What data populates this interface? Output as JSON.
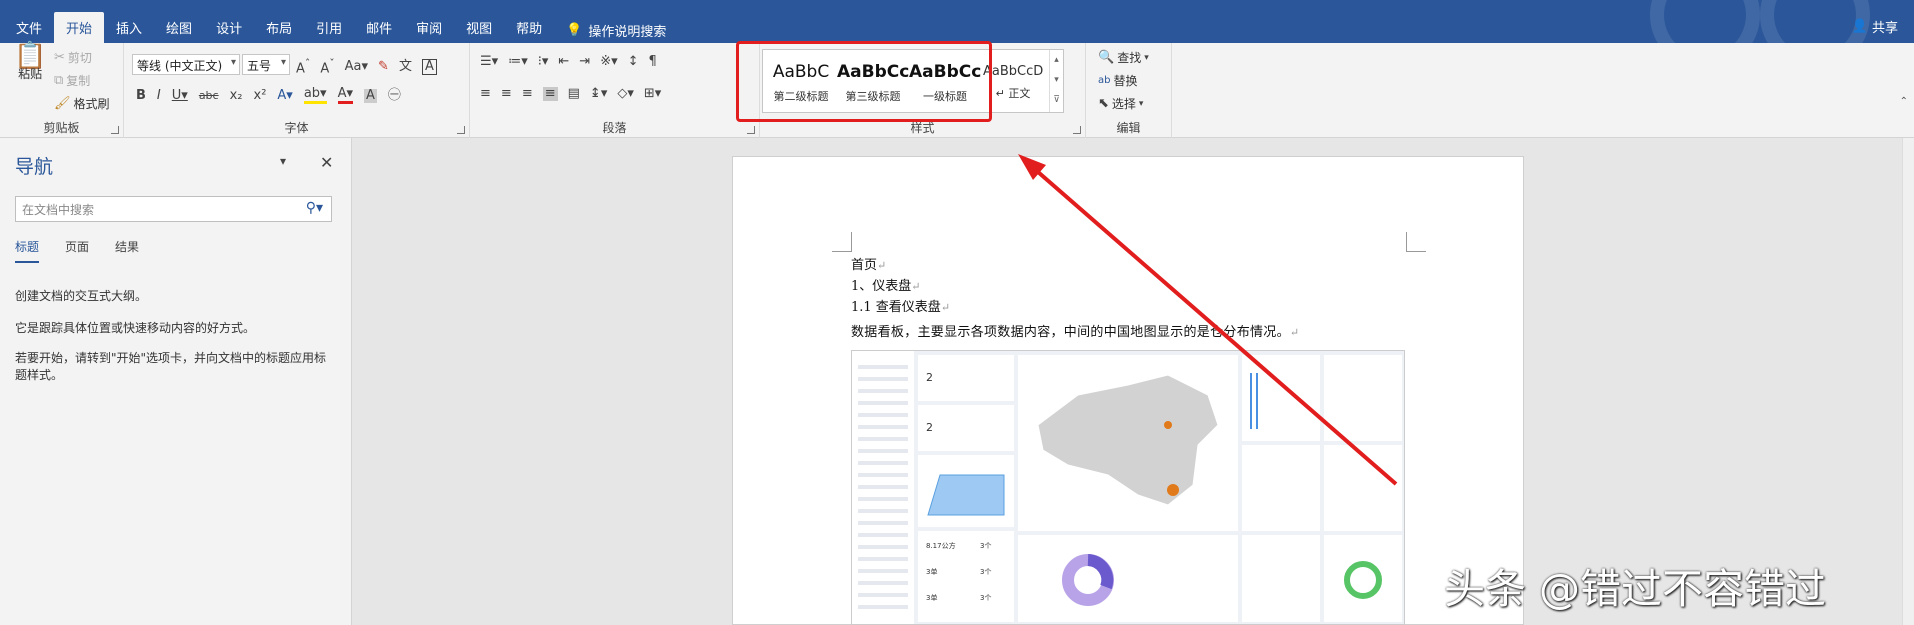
{
  "tabs": [
    "文件",
    "开始",
    "插入",
    "绘图",
    "设计",
    "布局",
    "引用",
    "邮件",
    "审阅",
    "视图",
    "帮助"
  ],
  "tell_me": "操作说明搜索",
  "share": "共享",
  "clipboard": {
    "paste": "粘贴",
    "cut": "剪切",
    "copy": "复制",
    "format_painter": "格式刷",
    "label": "剪贴板"
  },
  "font": {
    "family": "等线 (中文正文)",
    "size": "五号",
    "label": "字体"
  },
  "paragraph": {
    "label": "段落"
  },
  "styles": {
    "label": "样式",
    "items": [
      {
        "sample": "AaBbC",
        "name": "第二级标题"
      },
      {
        "sample": "AaBbCc",
        "name": "第三级标题"
      },
      {
        "sample": "AaBbCc",
        "name": "一级标题"
      },
      {
        "sample": "AaBbCcDd",
        "name": "正文"
      }
    ]
  },
  "editing": {
    "find": "查找",
    "replace": "替换",
    "select": "选择",
    "label": "编辑"
  },
  "nav": {
    "title": "导航",
    "search_placeholder": "在文档中搜索",
    "tabs": [
      "标题",
      "页面",
      "结果"
    ],
    "help1": "创建文档的交互式大纲。",
    "help2": "它是跟踪具体位置或快速移动内容的好方式。",
    "help3": "若要开始，请转到\"开始\"选项卡，并向文档中的标题应用标题样式。"
  },
  "doc": {
    "lines": [
      "首页",
      "1、仪表盘",
      "1.1 查看仪表盘",
      "数据看板，主要显示各项数据内容，中间的中国地图显示的是仓分布情况。"
    ]
  },
  "dashboard": {
    "stat1": "2",
    "stat2": "2",
    "stats": [
      "8.17公方",
      "3个",
      "3单",
      "3个",
      "3单",
      "3个"
    ]
  },
  "watermark": "头条 @错过不容错过",
  "colors": {
    "ribbon_blue": "#2b579a",
    "annotation_red": "#e21d1d"
  }
}
